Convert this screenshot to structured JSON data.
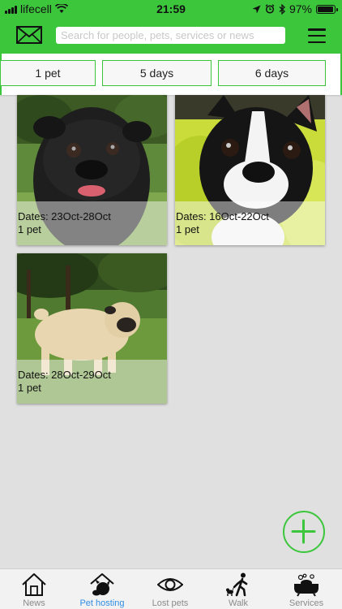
{
  "status_bar": {
    "carrier": "lifecell",
    "time": "21:59",
    "battery_percent": "97%",
    "battery_level": 0.97
  },
  "header": {
    "search_placeholder": "Search for people, pets, services or news",
    "icons": [
      "mail-icon",
      "menu-icon"
    ]
  },
  "filters": [
    {
      "label": "1 pet"
    },
    {
      "label": "5 days"
    },
    {
      "label": "6 days"
    }
  ],
  "listings": [
    {
      "dates": "Dates: 23Oct-28Oct",
      "pets": "1 pet",
      "photo": "black pug"
    },
    {
      "dates": "Dates: 16Oct-22Oct",
      "pets": "1 pet",
      "photo": "boston terrier"
    },
    {
      "dates": "Dates: 28Oct-29Oct",
      "pets": "1 pet",
      "photo": "fawn pug"
    }
  ],
  "tabs": [
    {
      "label": "News",
      "icon": "house-icon"
    },
    {
      "label": "Pet hosting",
      "icon": "pet-hosting-icon",
      "active": true
    },
    {
      "label": "Lost pets",
      "icon": "eye-icon"
    },
    {
      "label": "Walk",
      "icon": "walk-icon"
    },
    {
      "label": "Services",
      "icon": "pet-bath-icon"
    }
  ],
  "colors": {
    "brand_green": "#3cc63c",
    "active_tab": "#2f8de4",
    "inactive_tab": "#8a8a8a",
    "background": "#e0e0e0"
  }
}
